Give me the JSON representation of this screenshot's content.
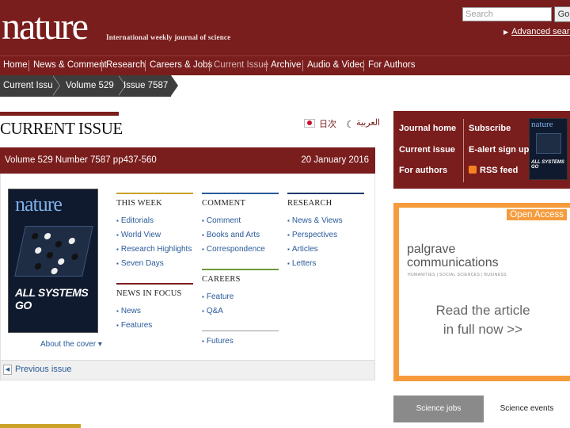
{
  "header": {
    "logo": "nature",
    "tagline": "International weekly journal of science",
    "search_placeholder": "Search",
    "go_label": "Go",
    "advanced_search": "Advanced search"
  },
  "nav": {
    "items": [
      "Home",
      "News & Comment",
      "Research",
      "Careers & Jobs",
      "Current Issue",
      "Archive",
      "Audio & Video",
      "For Authors"
    ]
  },
  "breadcrumb": [
    "Current Issue",
    "Volume 529",
    "Issue 7587"
  ],
  "page": {
    "title": "CURRENT ISSUE",
    "lang_japanese": "日次",
    "lang_arabic": "العربية"
  },
  "issue": {
    "info": "Volume 529 Number 7587 pp437-560",
    "date": "20 January 2016",
    "about_cover": "About the cover",
    "previous": "Previous issue"
  },
  "cover": {
    "masthead": "nature",
    "headline": "ALL SYSTEMS GO"
  },
  "sections": {
    "this_week": {
      "title": "THIS WEEK",
      "links": [
        "Editorials",
        "World View",
        "Research Highlights",
        "Seven Days"
      ]
    },
    "news_in_focus": {
      "title": "NEWS IN FOCUS",
      "links": [
        "News",
        "Features"
      ]
    },
    "comment": {
      "title": "COMMENT",
      "links": [
        "Comment",
        "Books and Arts",
        "Correspondence"
      ]
    },
    "careers": {
      "title": "CAREERS",
      "links": [
        "Feature",
        "Q&A"
      ]
    },
    "futures": {
      "links": [
        "Futures"
      ]
    },
    "research": {
      "title": "RESEARCH",
      "links": [
        "News & Views",
        "Perspectives",
        "Articles",
        "Letters"
      ]
    }
  },
  "sidebar": {
    "journal_home": "Journal home",
    "current_issue": "Current issue",
    "for_authors": "For authors",
    "subscribe": "Subscribe",
    "ealert": "E-alert sign up",
    "rss": "RSS feed"
  },
  "ad": {
    "open_access": "Open Access",
    "brand_line1": "palgrave",
    "brand_line2": "communications",
    "brand_sub": "HUMANITIES | SOCIAL SCIENCES | BUSINESS",
    "cta": "Read the article in full now >>"
  },
  "bottom_tabs": {
    "jobs": "Science jobs",
    "events": "Science events"
  },
  "colors": {
    "brand": "#7a1d1d",
    "link": "#2a5a99",
    "ad_accent": "#f59b3c"
  }
}
